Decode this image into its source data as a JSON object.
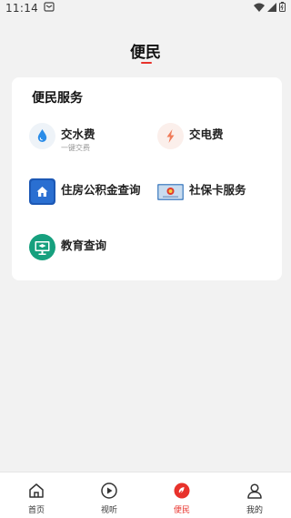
{
  "status_bar": {
    "time": "11:14"
  },
  "header": {
    "title": "便民"
  },
  "section": {
    "title": "便民服务",
    "items": [
      {
        "name": "交水费",
        "subtitle": "一键交费",
        "icon": "water-drop-icon"
      },
      {
        "name": "交电费",
        "icon": "lightning-icon"
      },
      {
        "name": "住房公积金查询",
        "icon": "house-icon"
      },
      {
        "name": "社保卡服务",
        "icon": "social-security-card-icon"
      },
      {
        "name": "教育查询",
        "icon": "education-monitor-icon"
      }
    ]
  },
  "tabbar": {
    "active": "便民",
    "tabs": [
      {
        "label": "首页",
        "icon": "home-icon"
      },
      {
        "label": "视听",
        "icon": "play-icon"
      },
      {
        "label": "便民",
        "icon": "convenience-icon"
      },
      {
        "label": "我的",
        "icon": "user-icon"
      }
    ]
  },
  "colors": {
    "accent": "#e8322b",
    "background": "#f2f2f2",
    "card": "#ffffff"
  }
}
